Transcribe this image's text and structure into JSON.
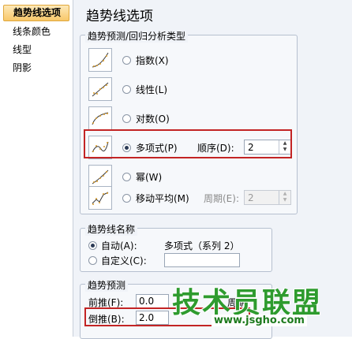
{
  "sidebar": {
    "items": [
      {
        "label": "趋势线选项",
        "active": true
      },
      {
        "label": "线条颜色"
      },
      {
        "label": "线型"
      },
      {
        "label": "阴影"
      }
    ]
  },
  "main": {
    "title": "趋势线选项"
  },
  "trend_type": {
    "legend": "趋势预测/回归分析类型",
    "options": [
      {
        "label": "指数(X)",
        "icon": "exponential-trend-icon"
      },
      {
        "label": "线性(L)",
        "icon": "linear-trend-icon"
      },
      {
        "label": "对数(O)",
        "icon": "logarithmic-trend-icon"
      },
      {
        "label": "多项式(P)",
        "icon": "polynomial-trend-icon",
        "selected": true,
        "order_label": "顺序(D):",
        "order_value": "2"
      },
      {
        "label": "幂(W)",
        "icon": "power-trend-icon"
      },
      {
        "label": "移动平均(M)",
        "icon": "moving-average-trend-icon",
        "period_label": "周期(E):",
        "period_value": "2"
      }
    ]
  },
  "trend_name": {
    "legend": "趋势线名称",
    "auto_label": "自动(A):",
    "auto_value": "多项式（系列 2）",
    "custom_label": "自定义(C):",
    "custom_value": ""
  },
  "forecast": {
    "legend": "趋势预测",
    "forward_label": "前推(F):",
    "forward_value": "0.0",
    "forward_unit": "周期",
    "backward_label": "倒推(B):",
    "backward_value": "2.0",
    "backward_unit": "周期"
  },
  "watermark": {
    "text": "技术员联盟",
    "url": "www.jsgho.com"
  },
  "colors": {
    "highlight": "#c32424",
    "watermark": "#2e9b2e"
  }
}
